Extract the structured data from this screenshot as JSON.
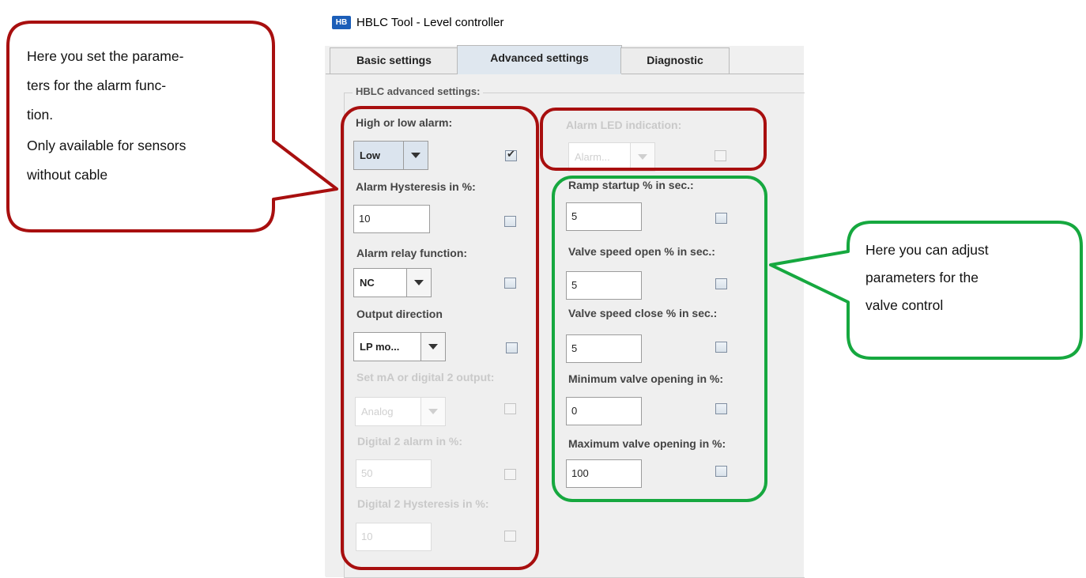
{
  "window": {
    "icon_text": "HB",
    "title": "HBLC Tool - Level controller"
  },
  "tabs": [
    {
      "label": "Basic settings",
      "active": false
    },
    {
      "label": "Advanced settings",
      "active": true
    },
    {
      "label": "Diagnostic",
      "active": false
    }
  ],
  "group_title": "HBLC advanced settings:",
  "left_column": {
    "high_low_alarm": {
      "label": "High or low alarm:",
      "value": "Low",
      "checked": true
    },
    "alarm_hysteresis": {
      "label": "Alarm Hysteresis in %:",
      "value": "10",
      "checked": false
    },
    "alarm_relay_function": {
      "label": "Alarm relay function:",
      "value": "NC",
      "checked": false
    },
    "output_direction": {
      "label": "Output direction",
      "value": "LP mo...",
      "checked": false
    },
    "set_ma_digital": {
      "label": "Set mA or digital 2 output:",
      "value": "Analog",
      "checked": false,
      "disabled": true
    },
    "digital2_alarm": {
      "label": "Digital 2 alarm in %:",
      "value": "50",
      "checked": false,
      "disabled": true
    },
    "digital2_hysteresis": {
      "label": "Digital 2 Hysteresis in %:",
      "value": "10",
      "checked": false,
      "disabled": true
    }
  },
  "right_column": {
    "alarm_led": {
      "label": "Alarm LED indication:",
      "value": "Alarm...",
      "checked": false,
      "disabled": true
    },
    "ramp_startup": {
      "label": "Ramp startup % in sec.:",
      "value": "5",
      "checked": false
    },
    "valve_speed_open": {
      "label": "Valve speed open % in sec.:",
      "value": "5",
      "checked": false
    },
    "valve_speed_close": {
      "label": "Valve speed close % in sec.:",
      "value": "5",
      "checked": false
    },
    "min_valve_opening": {
      "label": "Minimum valve opening in %:",
      "value": "0",
      "checked": false
    },
    "max_valve_opening": {
      "label": "Maximum valve opening in %:",
      "value": "100",
      "checked": false
    }
  },
  "annotations": {
    "left_callout": {
      "line1": "Here you set the parame-",
      "line2": "ters for the alarm func-",
      "line3": "tion.",
      "line4": "Only available for sensors",
      "line5": "without cable",
      "color": "#a80f0f"
    },
    "right_callout": {
      "line1": "Here you can adjust",
      "line2": "parameters for the",
      "line3": "valve control",
      "color": "#16a83f"
    }
  }
}
